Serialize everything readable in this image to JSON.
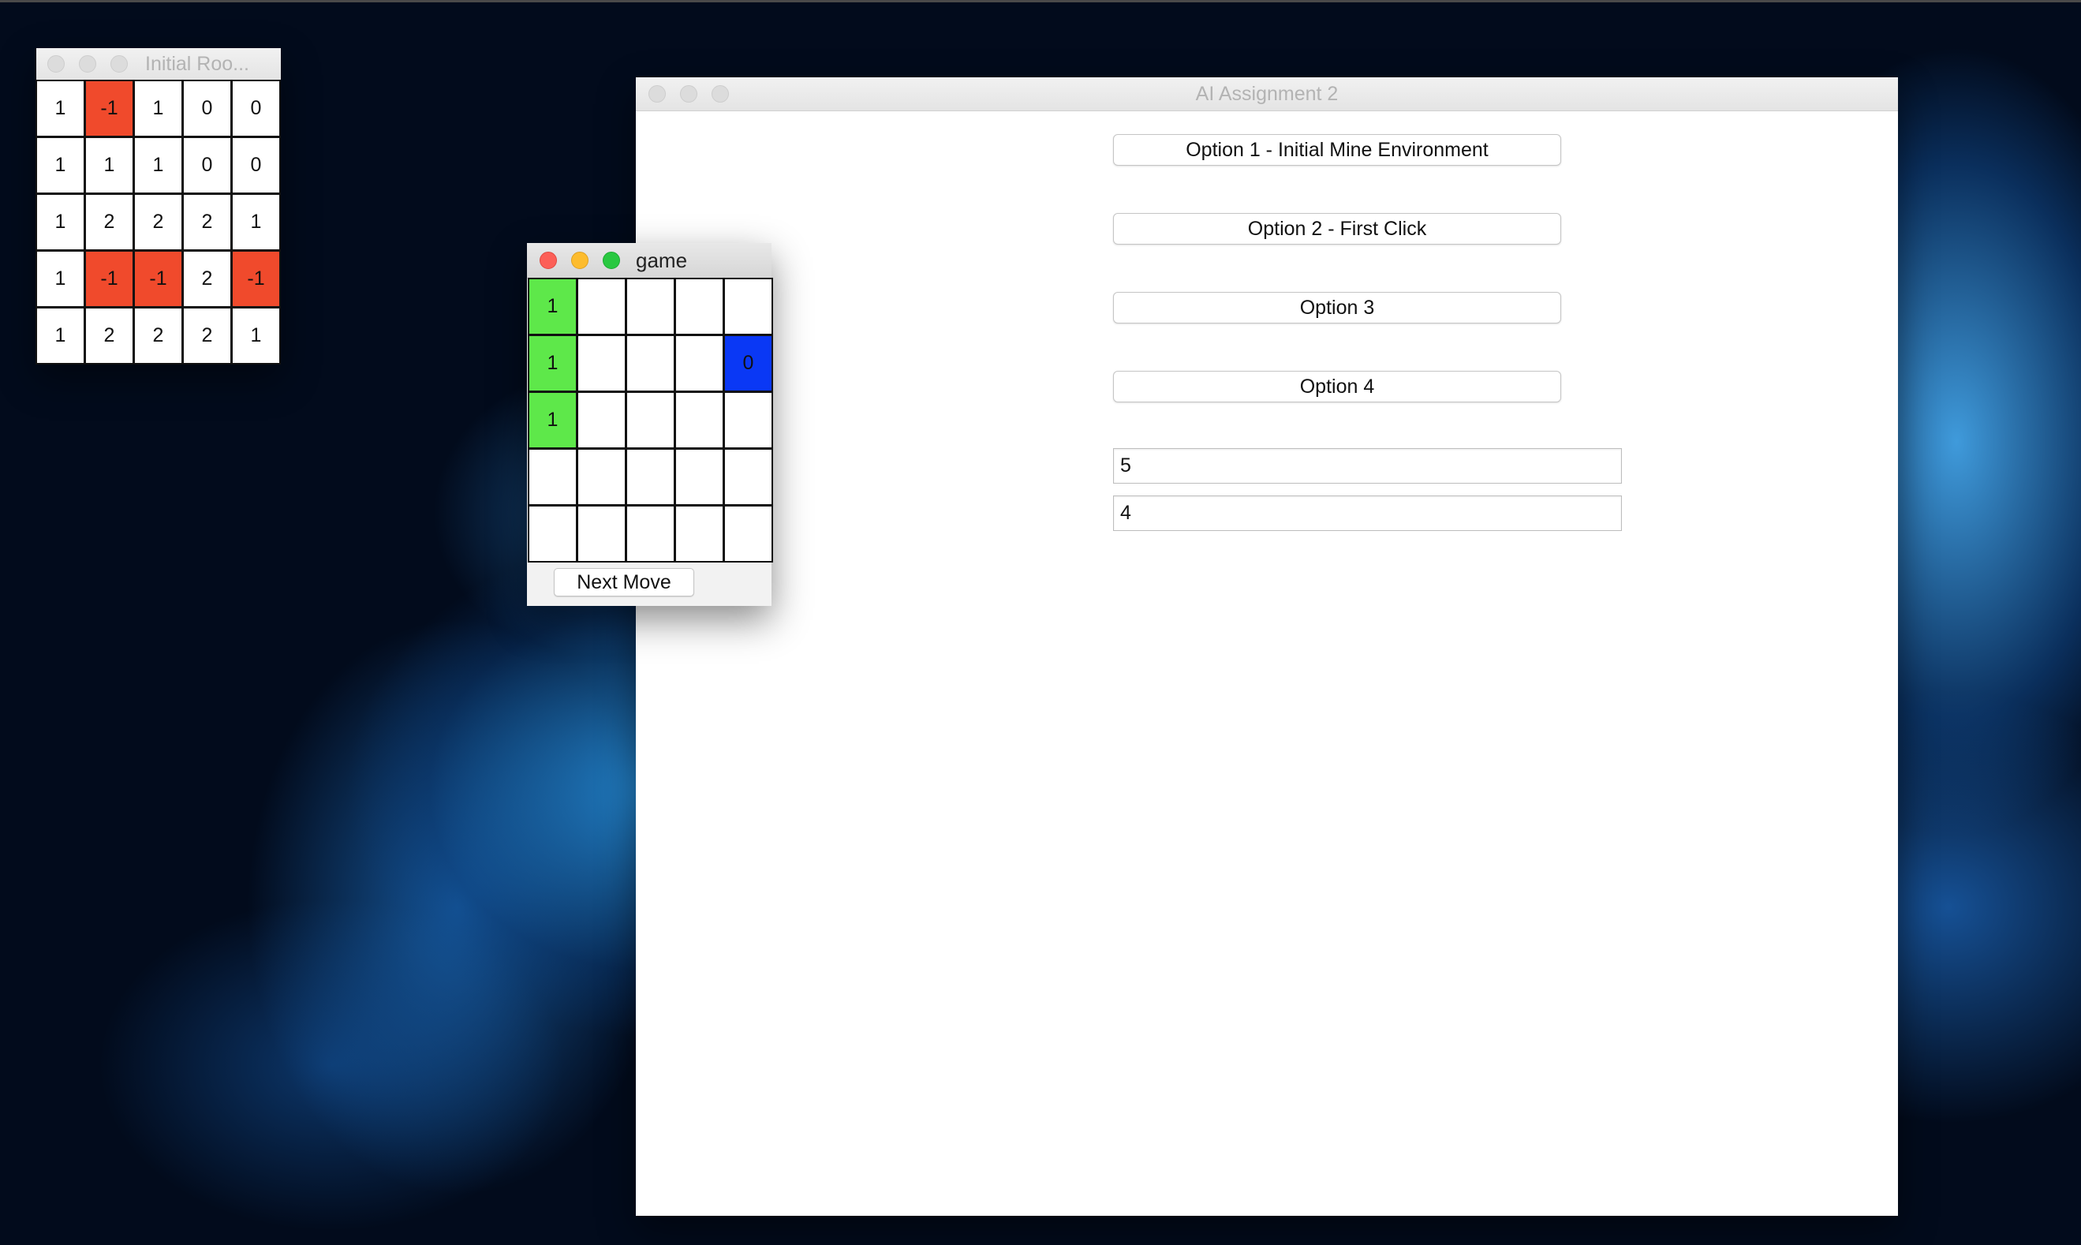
{
  "initial_window": {
    "title": "Initial Roo...",
    "grid": [
      [
        "1",
        "-1",
        "1",
        "0",
        "0"
      ],
      [
        "1",
        "1",
        "1",
        "0",
        "0"
      ],
      [
        "1",
        "2",
        "2",
        "2",
        "1"
      ],
      [
        "1",
        "-1",
        "-1",
        "2",
        "-1"
      ],
      [
        "1",
        "2",
        "2",
        "2",
        "1"
      ]
    ]
  },
  "game_window": {
    "title": "game",
    "grid": [
      [
        "1",
        "",
        "",
        "",
        ""
      ],
      [
        "1",
        "",
        "",
        "",
        "0"
      ],
      [
        "1",
        "",
        "",
        "",
        ""
      ],
      [
        "",
        "",
        "",
        "",
        ""
      ],
      [
        "",
        "",
        "",
        "",
        ""
      ]
    ],
    "next_move_label": "Next Move"
  },
  "main_window": {
    "title": "AI Assignment 2",
    "option1_label": "Option 1 - Initial Mine Environment",
    "option2_label": "Option 2 - First Click",
    "option3_label": "Option 3",
    "option4_label": "Option 4",
    "field1_value": "5",
    "field2_value": "4"
  },
  "colors": {
    "mine_cell": "#f04a2c",
    "revealed_cell": "#5ee84a",
    "current_cell": "#0a38f5"
  }
}
